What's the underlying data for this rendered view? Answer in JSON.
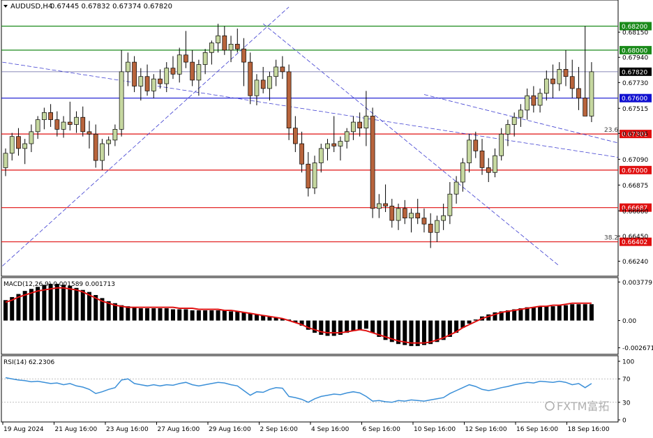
{
  "header": {
    "symbol": "AUDUSD,H4",
    "ohlc": "0.67445 0.67832 0.67374 0.67820"
  },
  "indicators": {
    "macd_label": "MACD(12,26,9) 0.001589 0.001713",
    "rsi_label": "RSI(14) 62.2306"
  },
  "watermark": "FXTM富拓",
  "colors": {
    "bull_body": "#c6d8a0",
    "bear_body": "#b8643c",
    "wick": "#000000",
    "green_line": "#1a8a1a",
    "blue_line": "#1010d0",
    "red_line": "#e01010",
    "macd_signal": "#e01010",
    "rsi_line": "#3a8fd8",
    "trend_dash": "#3a3ad0"
  },
  "chart_data": {
    "type": "candlestick",
    "y_range": [
      0.6615,
      0.6836
    ],
    "price_ticks": [
      "0.68150",
      "0.67940",
      "0.67730",
      "0.67515",
      "0.67305",
      "0.67090",
      "0.66875",
      "0.66660",
      "0.66450",
      "0.66240"
    ],
    "x_labels": [
      "19 Aug 2024",
      "21 Aug 16:00",
      "23 Aug 16:00",
      "27 Aug 16:00",
      "29 Aug 16:00",
      "2 Sep 16:00",
      "4 Sep 16:00",
      "6 Sep 16:00",
      "10 Sep 16:00",
      "12 Sep 16:00",
      "16 Sep 16:00",
      "18 Sep 16:00"
    ],
    "levels": [
      {
        "price": 0.682,
        "label": "0.68200",
        "color": "green",
        "role": "level"
      },
      {
        "price": 0.68,
        "label": "0.68000",
        "color": "green",
        "role": "level"
      },
      {
        "price": 0.6782,
        "label": "0.67820",
        "color": "slate",
        "role": "current"
      },
      {
        "price": 0.676,
        "label": "0.67600",
        "color": "blue",
        "role": "level"
      },
      {
        "price": 0.67301,
        "label": "0.67301",
        "color": "red",
        "role": "level"
      },
      {
        "price": 0.67,
        "label": "0.67000",
        "color": "red",
        "role": "level"
      },
      {
        "price": 0.66687,
        "label": "0.66687",
        "color": "red",
        "role": "level"
      },
      {
        "price": 0.66402,
        "label": "0.66402",
        "color": "red",
        "role": "level"
      }
    ],
    "fib_labels": [
      {
        "text": "23.6",
        "price": 0.67301
      },
      {
        "text": "38.2",
        "price": 0.66402
      }
    ],
    "candles": [
      [
        0.6702,
        0.6718,
        0.6695,
        0.6714
      ],
      [
        0.6714,
        0.6731,
        0.6708,
        0.6728
      ],
      [
        0.6728,
        0.6735,
        0.6712,
        0.6718
      ],
      [
        0.6718,
        0.6726,
        0.6705,
        0.6722
      ],
      [
        0.6722,
        0.6738,
        0.6715,
        0.6732
      ],
      [
        0.6732,
        0.6745,
        0.6726,
        0.6742
      ],
      [
        0.6742,
        0.6752,
        0.6734,
        0.6748
      ],
      [
        0.6748,
        0.6755,
        0.6736,
        0.6742
      ],
      [
        0.6742,
        0.6749,
        0.6728,
        0.6734
      ],
      [
        0.6734,
        0.6745,
        0.6727,
        0.674
      ],
      [
        0.674,
        0.6757,
        0.6733,
        0.6738
      ],
      [
        0.6738,
        0.6749,
        0.6731,
        0.6744
      ],
      [
        0.6744,
        0.6753,
        0.6728,
        0.6732
      ],
      [
        0.6732,
        0.6741,
        0.6718,
        0.673
      ],
      [
        0.673,
        0.6738,
        0.6702,
        0.6708
      ],
      [
        0.6708,
        0.6726,
        0.67,
        0.6722
      ],
      [
        0.6722,
        0.6728,
        0.6712,
        0.6725
      ],
      [
        0.6725,
        0.6738,
        0.672,
        0.6734
      ],
      [
        0.6734,
        0.68,
        0.6728,
        0.6782
      ],
      [
        0.6782,
        0.6798,
        0.677,
        0.679
      ],
      [
        0.679,
        0.6795,
        0.6765,
        0.677
      ],
      [
        0.677,
        0.6785,
        0.6758,
        0.6778
      ],
      [
        0.6778,
        0.6788,
        0.6762,
        0.6766
      ],
      [
        0.6766,
        0.678,
        0.676,
        0.6776
      ],
      [
        0.6776,
        0.6784,
        0.6768,
        0.6772
      ],
      [
        0.6772,
        0.679,
        0.6765,
        0.6785
      ],
      [
        0.6785,
        0.6795,
        0.6776,
        0.678
      ],
      [
        0.678,
        0.6802,
        0.6773,
        0.6796
      ],
      [
        0.6796,
        0.6816,
        0.6785,
        0.679
      ],
      [
        0.679,
        0.68,
        0.677,
        0.6775
      ],
      [
        0.6775,
        0.6792,
        0.6762,
        0.6788
      ],
      [
        0.6788,
        0.6801,
        0.678,
        0.6798
      ],
      [
        0.6798,
        0.6808,
        0.6788,
        0.6806
      ],
      [
        0.6806,
        0.6822,
        0.6798,
        0.6812
      ],
      [
        0.6812,
        0.682,
        0.6796,
        0.68
      ],
      [
        0.68,
        0.6812,
        0.679,
        0.6805
      ],
      [
        0.6805,
        0.6818,
        0.6798,
        0.6801
      ],
      [
        0.6801,
        0.681,
        0.677,
        0.679
      ],
      [
        0.679,
        0.6798,
        0.6755,
        0.6762
      ],
      [
        0.6762,
        0.678,
        0.6754,
        0.6775
      ],
      [
        0.6775,
        0.6786,
        0.6764,
        0.6768
      ],
      [
        0.6768,
        0.6782,
        0.6758,
        0.6778
      ],
      [
        0.6778,
        0.6792,
        0.677,
        0.6786
      ],
      [
        0.6786,
        0.6795,
        0.6776,
        0.6782
      ],
      [
        0.6782,
        0.6788,
        0.6725,
        0.6735
      ],
      [
        0.6735,
        0.6745,
        0.6715,
        0.6722
      ],
      [
        0.6722,
        0.6732,
        0.6698,
        0.6705
      ],
      [
        0.6705,
        0.6715,
        0.6678,
        0.6685
      ],
      [
        0.6685,
        0.6712,
        0.668,
        0.6706
      ],
      [
        0.6706,
        0.6722,
        0.6698,
        0.6718
      ],
      [
        0.6718,
        0.6726,
        0.6708,
        0.6722
      ],
      [
        0.6722,
        0.6745,
        0.6715,
        0.672
      ],
      [
        0.672,
        0.6728,
        0.6708,
        0.6724
      ],
      [
        0.6724,
        0.6735,
        0.6718,
        0.6732
      ],
      [
        0.6732,
        0.6745,
        0.6725,
        0.674
      ],
      [
        0.674,
        0.6748,
        0.6728,
        0.6735
      ],
      [
        0.6735,
        0.6766,
        0.672,
        0.6745
      ],
      [
        0.6745,
        0.6752,
        0.666,
        0.6668
      ],
      [
        0.6668,
        0.668,
        0.666,
        0.6672
      ],
      [
        0.6672,
        0.6688,
        0.6665,
        0.667
      ],
      [
        0.667,
        0.6676,
        0.6652,
        0.6658
      ],
      [
        0.6658,
        0.6672,
        0.665,
        0.6668
      ],
      [
        0.6668,
        0.6675,
        0.6655,
        0.666
      ],
      [
        0.666,
        0.6668,
        0.6648,
        0.6664
      ],
      [
        0.6664,
        0.6676,
        0.6655,
        0.666
      ],
      [
        0.666,
        0.6668,
        0.6648,
        0.6655
      ],
      [
        0.6655,
        0.6664,
        0.6635,
        0.6648
      ],
      [
        0.6648,
        0.6662,
        0.664,
        0.6658
      ],
      [
        0.6658,
        0.6672,
        0.665,
        0.6662
      ],
      [
        0.6662,
        0.669,
        0.6655,
        0.668
      ],
      [
        0.668,
        0.6695,
        0.6672,
        0.669
      ],
      [
        0.669,
        0.671,
        0.6682,
        0.6706
      ],
      [
        0.6706,
        0.673,
        0.6698,
        0.6725
      ],
      [
        0.6725,
        0.6732,
        0.671,
        0.6716
      ],
      [
        0.6716,
        0.6726,
        0.6696,
        0.6702
      ],
      [
        0.6702,
        0.671,
        0.669,
        0.6698
      ],
      [
        0.6698,
        0.6718,
        0.6694,
        0.6712
      ],
      [
        0.6712,
        0.6735,
        0.6708,
        0.673
      ],
      [
        0.673,
        0.6742,
        0.672,
        0.6738
      ],
      [
        0.6738,
        0.6748,
        0.6728,
        0.6744
      ],
      [
        0.6744,
        0.6755,
        0.6736,
        0.675
      ],
      [
        0.675,
        0.6768,
        0.6742,
        0.6762
      ],
      [
        0.6762,
        0.677,
        0.6748,
        0.6754
      ],
      [
        0.6754,
        0.6768,
        0.6748,
        0.6764
      ],
      [
        0.6764,
        0.6783,
        0.6758,
        0.6776
      ],
      [
        0.6776,
        0.6788,
        0.676,
        0.6772
      ],
      [
        0.6772,
        0.679,
        0.6766,
        0.6784
      ],
      [
        0.6784,
        0.68,
        0.677,
        0.6778
      ],
      [
        0.6778,
        0.6792,
        0.676,
        0.6768
      ],
      [
        0.6768,
        0.6786,
        0.675,
        0.676
      ],
      [
        0.676,
        0.682,
        0.6755,
        0.6745
      ],
      [
        0.6745,
        0.679,
        0.674,
        0.6782
      ]
    ],
    "trend_lines": [
      {
        "from": [
          -0.5,
          0.662
        ],
        "to": [
          44,
          0.6836
        ]
      },
      {
        "from": [
          -0.5,
          0.679
        ],
        "to": [
          120,
          0.669
        ]
      },
      {
        "from": [
          40,
          0.6822
        ],
        "to": [
          86,
          0.662
        ]
      },
      {
        "from": [
          65,
          0.6763
        ],
        "to": [
          112,
          0.67
        ]
      }
    ],
    "macd": {
      "label": "MACD(12,26,9) 0.001589 0.001713",
      "range": [
        -0.0029,
        0.0038
      ],
      "ticks": [
        "0.003779",
        "0.00",
        "-0.002671"
      ],
      "histogram": [
        0.002,
        0.0023,
        0.0026,
        0.0029,
        0.0031,
        0.0033,
        0.0035,
        0.0036,
        0.0036,
        0.0035,
        0.0034,
        0.0032,
        0.003,
        0.0028,
        0.0025,
        0.0022,
        0.0019,
        0.0017,
        0.0015,
        0.0014,
        0.0013,
        0.0012,
        0.0012,
        0.0012,
        0.0012,
        0.0012,
        0.0011,
        0.0011,
        0.0011,
        0.001,
        0.001,
        0.001,
        0.001,
        0.001,
        0.001,
        0.0009,
        0.0009,
        0.0008,
        0.0007,
        0.0006,
        0.0005,
        0.0004,
        0.0003,
        0.0002,
        0.0001,
        -0.0002,
        -0.0005,
        -0.0009,
        -0.0012,
        -0.0014,
        -0.0015,
        -0.0015,
        -0.0014,
        -0.0012,
        -0.001,
        -0.0009,
        -0.0008,
        -0.0012,
        -0.0016,
        -0.0019,
        -0.0021,
        -0.0023,
        -0.0024,
        -0.0025,
        -0.0025,
        -0.0024,
        -0.0023,
        -0.0021,
        -0.0019,
        -0.0016,
        -0.0012,
        -0.0007,
        -0.0003,
        0.0001,
        0.0004,
        0.0006,
        0.0008,
        0.0009,
        0.001,
        0.0011,
        0.0012,
        0.0013,
        0.0013,
        0.0014,
        0.0014,
        0.0014,
        0.0015,
        0.0015,
        0.0016,
        0.0016,
        0.0016,
        0.0016
      ],
      "signal": [
        0.0018,
        0.002,
        0.0023,
        0.0025,
        0.0027,
        0.0029,
        0.003,
        0.0031,
        0.0032,
        0.0032,
        0.0031,
        0.003,
        0.0028,
        0.0025,
        0.0022,
        0.0019,
        0.0017,
        0.0015,
        0.0014,
        0.0013,
        0.0013,
        0.0013,
        0.0013,
        0.0013,
        0.0013,
        0.0013,
        0.0013,
        0.0012,
        0.0012,
        0.0012,
        0.0011,
        0.0011,
        0.0011,
        0.0011,
        0.001,
        0.001,
        0.0009,
        0.0008,
        0.0007,
        0.0006,
        0.0005,
        0.0004,
        0.0003,
        0.0002,
        0.0,
        -0.0002,
        -0.0004,
        -0.0007,
        -0.0009,
        -0.0011,
        -0.0012,
        -0.0012,
        -0.0012,
        -0.0011,
        -0.001,
        -0.0009,
        -0.001,
        -0.0012,
        -0.0014,
        -0.0016,
        -0.0018,
        -0.002,
        -0.0021,
        -0.0022,
        -0.0022,
        -0.0022,
        -0.0021,
        -0.0019,
        -0.0017,
        -0.0014,
        -0.0011,
        -0.0007,
        -0.0004,
        -0.0001,
        0.0002,
        0.0004,
        0.0006,
        0.0008,
        0.0009,
        0.001,
        0.0011,
        0.0012,
        0.0013,
        0.0014,
        0.0014,
        0.0015,
        0.0015,
        0.0016,
        0.0017,
        0.0017,
        0.0017,
        0.0017
      ]
    },
    "rsi": {
      "label": "RSI(14) 62.2306",
      "range": [
        0,
        100
      ],
      "ticks": [
        "100",
        "70",
        "30",
        "0"
      ],
      "levels": [
        70,
        30
      ],
      "values": [
        72,
        70,
        68,
        67,
        65,
        66,
        64,
        62,
        63,
        60,
        62,
        58,
        56,
        52,
        45,
        48,
        52,
        55,
        68,
        70,
        62,
        60,
        58,
        60,
        58,
        60,
        59,
        62,
        64,
        60,
        58,
        60,
        62,
        64,
        63,
        60,
        58,
        50,
        42,
        48,
        47,
        52,
        55,
        54,
        40,
        38,
        35,
        30,
        36,
        40,
        42,
        44,
        43,
        46,
        48,
        46,
        40,
        32,
        33,
        31,
        30,
        33,
        32,
        34,
        33,
        32,
        34,
        36,
        38,
        45,
        50,
        55,
        60,
        57,
        52,
        50,
        52,
        55,
        57,
        60,
        62,
        64,
        63,
        66,
        65,
        64,
        66,
        64,
        60,
        62,
        55,
        62
      ]
    }
  }
}
